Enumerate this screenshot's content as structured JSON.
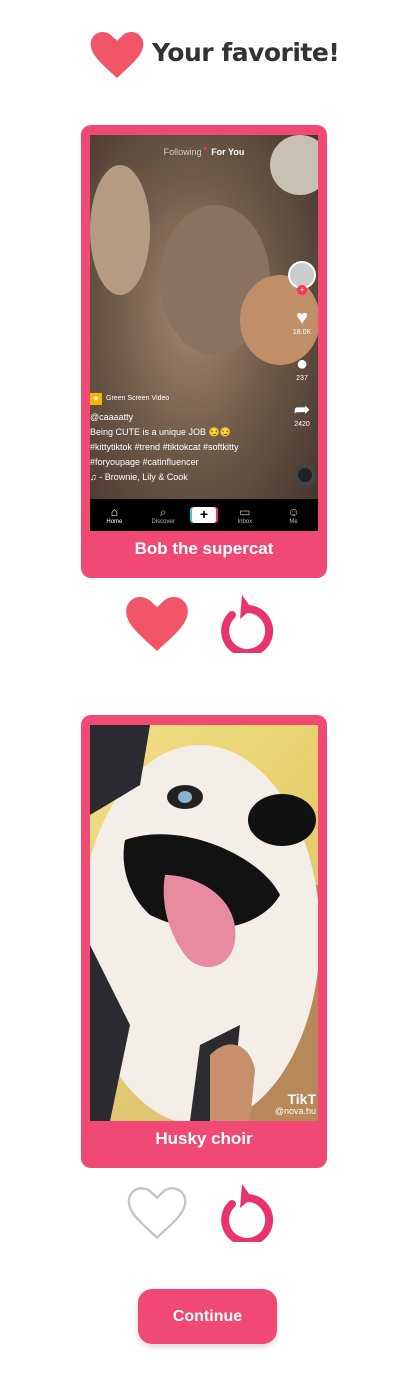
{
  "header": {
    "title": "Your favorite!"
  },
  "videos": [
    {
      "caption": "Bob the supercat",
      "liked": true,
      "ui": {
        "tab_following": "Following",
        "tab_for_you": "For You",
        "likes": "18.0K",
        "comments": "237",
        "shares": "2420",
        "badge": "Green Screen Video",
        "username": "@caaaatty",
        "description": "Being CUTE is a unique JOB 😏😏",
        "hashtags_1": "#kittytiktok #trend #tiktokcat #softkitty",
        "hashtags_2": "#foryoupage #catinfluencer",
        "music": "♫  - Brownie, Lily & Cook",
        "nav": [
          "Home",
          "Discover",
          "Inbox",
          "Me"
        ]
      }
    },
    {
      "caption": "Husky choir",
      "liked": false,
      "ui": {
        "watermark_logo": "TikT",
        "watermark_user": "@nova.hu"
      }
    }
  ],
  "continue_label": "Continue",
  "colors": {
    "accent": "#f04a74",
    "heart": "#f05568",
    "replay": "#e8336e"
  }
}
